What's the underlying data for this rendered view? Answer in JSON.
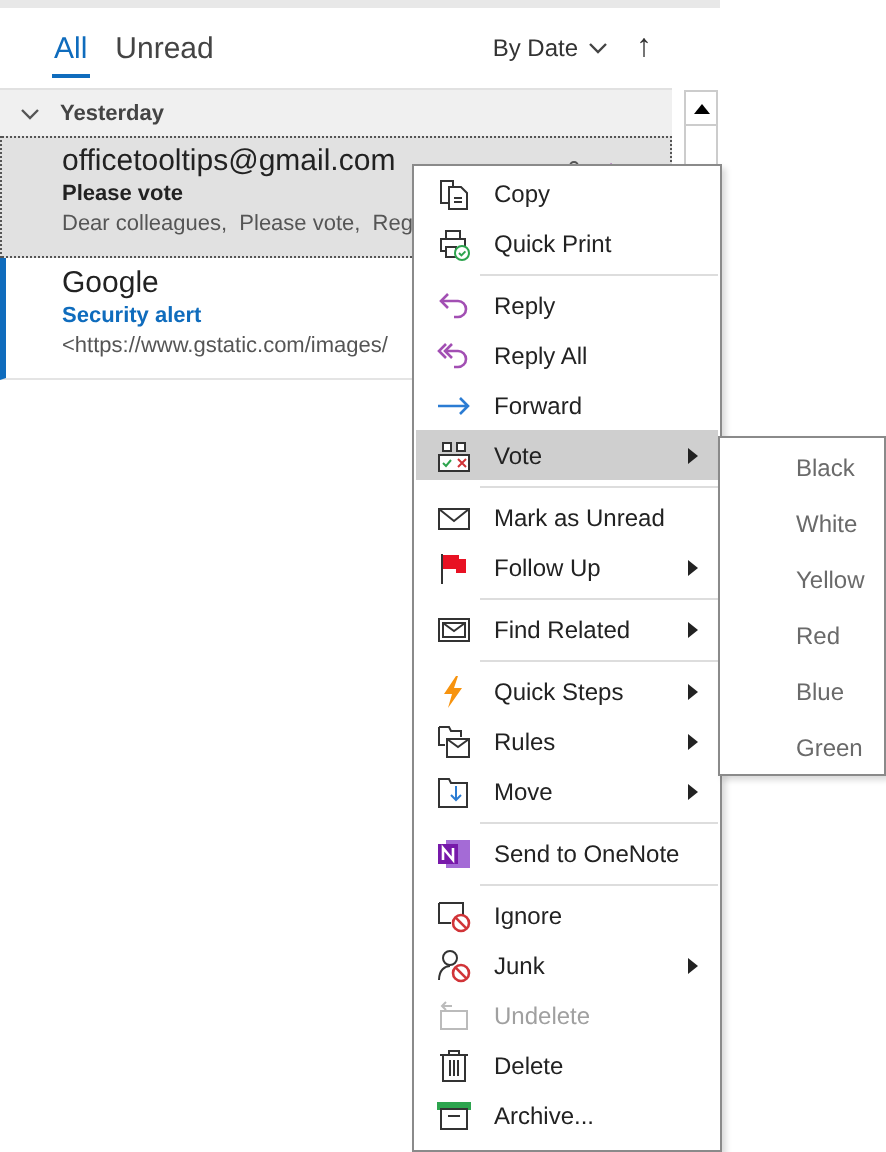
{
  "tabs": [
    {
      "label": "All",
      "selected": true
    },
    {
      "label": "Unread",
      "selected": false
    }
  ],
  "sort": {
    "label": "By Date",
    "arrow": "↑"
  },
  "group": {
    "label": "Yesterday",
    "expanded": true
  },
  "messages": [
    {
      "sender": "officetooltips@gmail.com",
      "subject": "Please vote",
      "preview": "Dear colleagues,  Please vote,  Reg",
      "selected": true,
      "unread": false
    },
    {
      "sender": "Google",
      "subject": "Security alert",
      "preview": "<https://www.gstatic.com/images/",
      "selected": false,
      "unread": true
    }
  ],
  "context_menu": [
    {
      "label": "Copy",
      "submenu": false,
      "disabled": false,
      "selected": false,
      "separator_before": false
    },
    {
      "label": "Quick Print",
      "submenu": false,
      "disabled": false,
      "selected": false,
      "separator_before": false
    },
    {
      "label": "Reply",
      "submenu": false,
      "disabled": false,
      "selected": false,
      "separator_before": true
    },
    {
      "label": "Reply All",
      "submenu": false,
      "disabled": false,
      "selected": false,
      "separator_before": false
    },
    {
      "label": "Forward",
      "submenu": false,
      "disabled": false,
      "selected": false,
      "separator_before": false
    },
    {
      "label": "Vote",
      "submenu": true,
      "disabled": false,
      "selected": true,
      "separator_before": false
    },
    {
      "label": "Mark as Unread",
      "submenu": false,
      "disabled": false,
      "selected": false,
      "separator_before": true
    },
    {
      "label": "Follow Up",
      "submenu": true,
      "disabled": false,
      "selected": false,
      "separator_before": false
    },
    {
      "label": "Find Related",
      "submenu": true,
      "disabled": false,
      "selected": false,
      "separator_before": true
    },
    {
      "label": "Quick Steps",
      "submenu": true,
      "disabled": false,
      "selected": false,
      "separator_before": true
    },
    {
      "label": "Rules",
      "submenu": true,
      "disabled": false,
      "selected": false,
      "separator_before": false
    },
    {
      "label": "Move",
      "submenu": true,
      "disabled": false,
      "selected": false,
      "separator_before": false
    },
    {
      "label": "Send to OneNote",
      "submenu": false,
      "disabled": false,
      "selected": false,
      "separator_before": true
    },
    {
      "label": "Ignore",
      "submenu": false,
      "disabled": false,
      "selected": false,
      "separator_before": true
    },
    {
      "label": "Junk",
      "submenu": true,
      "disabled": false,
      "selected": false,
      "separator_before": false
    },
    {
      "label": "Undelete",
      "submenu": false,
      "disabled": true,
      "selected": false,
      "separator_before": false
    },
    {
      "label": "Delete",
      "submenu": false,
      "disabled": false,
      "selected": false,
      "separator_before": false
    },
    {
      "label": "Archive...",
      "submenu": false,
      "disabled": false,
      "selected": false,
      "separator_before": false
    }
  ],
  "vote_submenu": [
    "Black",
    "White",
    "Yellow",
    "Red",
    "Blue",
    "Green"
  ]
}
